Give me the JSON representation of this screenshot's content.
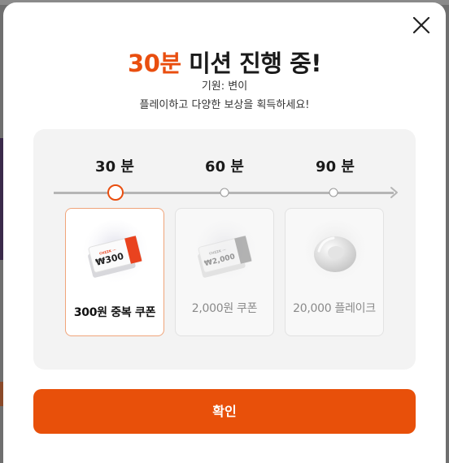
{
  "modal": {
    "title_accent": "30분",
    "title_rest": " 미션 진행 중!",
    "origin_line": "기원: 변이",
    "description": "플레이하고 다양한 보상을 획득하세요!",
    "close_icon": "close-icon"
  },
  "timeline": {
    "steps": [
      {
        "label": "30 분",
        "active": true
      },
      {
        "label": "60 분",
        "active": false
      },
      {
        "label": "90 분",
        "active": false
      }
    ]
  },
  "rewards": [
    {
      "name": "300원 중복 쿠폰",
      "coupon_value": "₩300",
      "icon": "coupon-icon",
      "active": true
    },
    {
      "name": "2,000원 쿠폰",
      "coupon_value": "₩2,000",
      "icon": "coupon-icon",
      "active": false
    },
    {
      "name": "20,000 플레이크",
      "icon": "flake-ring-icon",
      "active": false
    }
  ],
  "confirm_label": "확인",
  "colors": {
    "accent": "#e94e0f",
    "button": "#e8500a",
    "panel": "#f3f3f3"
  }
}
